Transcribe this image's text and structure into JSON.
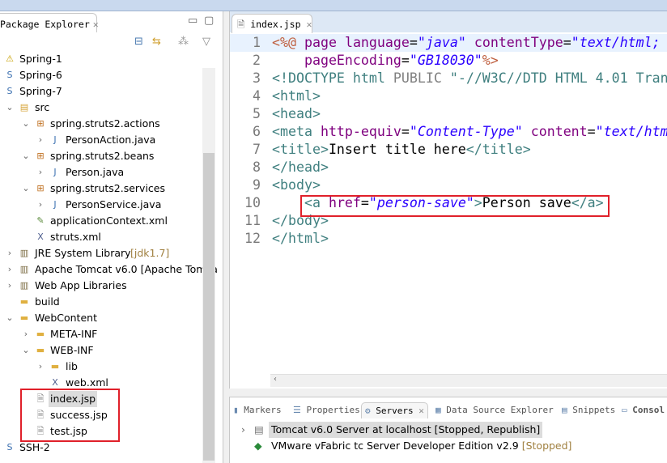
{
  "package_explorer": {
    "tab_label": "Package Explorer",
    "tree": [
      {
        "label": "Spring-1",
        "level": 0,
        "icon": "project-warning-icon",
        "arrow": ""
      },
      {
        "label": "Spring-6",
        "level": 0,
        "icon": "spring-project-icon",
        "arrow": ""
      },
      {
        "label": "Spring-7",
        "level": 0,
        "icon": "spring-project-icon",
        "arrow": ""
      },
      {
        "label": "src",
        "level": 1,
        "icon": "source-folder-icon",
        "arrow": "expanded"
      },
      {
        "label": "spring.struts2.actions",
        "level": 2,
        "icon": "package-icon",
        "arrow": "expanded"
      },
      {
        "label": "PersonAction.java",
        "level": 3,
        "icon": "java-file-icon",
        "arrow": "collapsed"
      },
      {
        "label": "spring.struts2.beans",
        "level": 2,
        "icon": "package-icon",
        "arrow": "expanded"
      },
      {
        "label": "Person.java",
        "level": 3,
        "icon": "java-file-icon",
        "arrow": "collapsed"
      },
      {
        "label": "spring.struts2.services",
        "level": 2,
        "icon": "package-icon",
        "arrow": "expanded"
      },
      {
        "label": "PersonService.java",
        "level": 3,
        "icon": "java-file-icon",
        "arrow": "collapsed"
      },
      {
        "label": "applicationContext.xml",
        "level": 2,
        "icon": "spring-xml-icon",
        "arrow": ""
      },
      {
        "label": "struts.xml",
        "level": 2,
        "icon": "xml-file-icon",
        "arrow": ""
      },
      {
        "label": "JRE System Library",
        "decoration": "[jdk1.7]",
        "level": 1,
        "icon": "library-icon",
        "arrow": "collapsed"
      },
      {
        "label": "Apache Tomcat v6.0 [Apache Tomca",
        "level": 1,
        "icon": "library-icon",
        "arrow": "collapsed"
      },
      {
        "label": "Web App Libraries",
        "level": 1,
        "icon": "library-icon",
        "arrow": "collapsed"
      },
      {
        "label": "build",
        "level": 1,
        "icon": "folder-icon",
        "arrow": ""
      },
      {
        "label": "WebContent",
        "level": 1,
        "icon": "folder-icon",
        "arrow": "expanded"
      },
      {
        "label": "META-INF",
        "level": 2,
        "icon": "folder-icon",
        "arrow": "collapsed"
      },
      {
        "label": "WEB-INF",
        "level": 2,
        "icon": "folder-icon",
        "arrow": "expanded"
      },
      {
        "label": "lib",
        "level": 3,
        "icon": "folder-icon",
        "arrow": "collapsed"
      },
      {
        "label": "web.xml",
        "level": 3,
        "icon": "xml-file-icon",
        "arrow": ""
      },
      {
        "label": "index.jsp",
        "level": 2,
        "icon": "jsp-file-icon",
        "arrow": "",
        "selected": true
      },
      {
        "label": "success.jsp",
        "level": 2,
        "icon": "jsp-file-icon",
        "arrow": ""
      },
      {
        "label": "test.jsp",
        "level": 2,
        "icon": "jsp-file-icon",
        "arrow": ""
      },
      {
        "label": "SSH-2",
        "level": 0,
        "icon": "spring-project-icon",
        "arrow": ""
      }
    ]
  },
  "editor": {
    "tab_label": "index.jsp",
    "lines": [
      {
        "n": "1",
        "tokens": [
          [
            "jsp",
            "<%@"
          ],
          [
            "txt",
            " "
          ],
          [
            "attr",
            "page"
          ],
          [
            "txt",
            " "
          ],
          [
            "attr",
            "language"
          ],
          [
            "txt",
            "="
          ],
          [
            "val",
            "\"java\""
          ],
          [
            "txt",
            " "
          ],
          [
            "attr",
            "contentType"
          ],
          [
            "txt",
            "="
          ],
          [
            "val",
            "\"text/html;"
          ]
        ]
      },
      {
        "n": "2",
        "tokens": [
          [
            "txt",
            "    "
          ],
          [
            "attr",
            "pageEncoding"
          ],
          [
            "txt",
            "="
          ],
          [
            "val",
            "\"GB18030\""
          ],
          [
            "jsp",
            "%>"
          ]
        ]
      },
      {
        "n": "3",
        "tokens": [
          [
            "doc",
            "<!DOCTYPE"
          ],
          [
            "txt",
            " "
          ],
          [
            "doc",
            "html"
          ],
          [
            "txt",
            " "
          ],
          [
            "pub",
            "PUBLIC"
          ],
          [
            "txt",
            " "
          ],
          [
            "doc",
            "\"-//W3C//DTD HTML 4.01 Tran"
          ]
        ]
      },
      {
        "n": "4",
        "tokens": [
          [
            "tag",
            "<html>"
          ]
        ]
      },
      {
        "n": "5",
        "tokens": [
          [
            "tag",
            "<head>"
          ]
        ]
      },
      {
        "n": "6",
        "tokens": [
          [
            "tag",
            "<meta"
          ],
          [
            "txt",
            " "
          ],
          [
            "attr",
            "http-equiv"
          ],
          [
            "txt",
            "="
          ],
          [
            "val",
            "\"Content-Type\""
          ],
          [
            "txt",
            " "
          ],
          [
            "attr",
            "content"
          ],
          [
            "txt",
            "="
          ],
          [
            "val",
            "\"text/htm"
          ]
        ]
      },
      {
        "n": "7",
        "tokens": [
          [
            "tag",
            "<title>"
          ],
          [
            "txt",
            "Insert title here"
          ],
          [
            "tag",
            "</title>"
          ]
        ]
      },
      {
        "n": "8",
        "tokens": [
          [
            "tag",
            "</head>"
          ]
        ]
      },
      {
        "n": "9",
        "tokens": [
          [
            "tag",
            "<body>"
          ]
        ]
      },
      {
        "n": "10",
        "tokens": [
          [
            "txt",
            "    "
          ],
          [
            "tag",
            "<a"
          ],
          [
            "txt",
            " "
          ],
          [
            "attr",
            "href"
          ],
          [
            "txt",
            "="
          ],
          [
            "val",
            "\"person-save\""
          ],
          [
            "tag",
            ">"
          ],
          [
            "txt",
            "Person save"
          ],
          [
            "tag",
            "</a>"
          ]
        ]
      },
      {
        "n": "11",
        "tokens": [
          [
            "tag",
            "</body>"
          ]
        ]
      },
      {
        "n": "12",
        "tokens": [
          [
            "tag",
            "</html>"
          ]
        ]
      }
    ]
  },
  "bottom_panel": {
    "tabs": [
      {
        "label": "Markers",
        "icon": "markers-icon"
      },
      {
        "label": "Properties",
        "icon": "properties-icon"
      },
      {
        "label": "Servers",
        "icon": "servers-icon",
        "active": true
      },
      {
        "label": "Data Source Explorer",
        "icon": "data-source-icon"
      },
      {
        "label": "Snippets",
        "icon": "snippets-icon"
      },
      {
        "label": "Consol",
        "icon": "console-icon"
      }
    ],
    "servers": [
      {
        "name": "Tomcat v6.0 Server at localhost",
        "status": "[Stopped, Republish]",
        "icon": "tomcat-server-icon"
      },
      {
        "name": "VMware vFabric tc Server Developer Edition v2.9",
        "status": "[Stopped]",
        "icon": "vfabric-server-icon"
      }
    ]
  },
  "colors": {
    "highlight_box": "#e0202a",
    "tag": "#3f7f7f",
    "attribute": "#7f007f",
    "value": "#2a00ff",
    "selection": "#dcdcdc"
  }
}
